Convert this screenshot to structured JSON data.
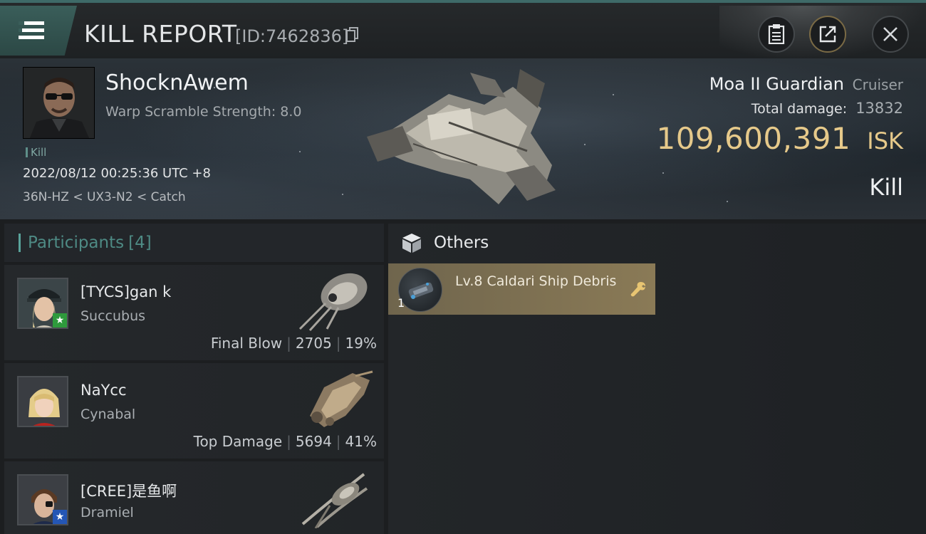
{
  "header": {
    "title": "KILL REPORT",
    "report_id": "[ID:7462836]",
    "icons": [
      "menu-icon",
      "copy-icon",
      "clipboard-icon",
      "share-icon",
      "close-icon"
    ]
  },
  "victim": {
    "name": "ShocknAwem",
    "attribute": "Warp Scramble Strength: 8.0",
    "tag": "Kill",
    "timestamp": "2022/08/12 00:25:36 UTC +8",
    "location": "36N-HZ < UX3-N2 < Catch",
    "ship_name": "Moa II Guardian",
    "ship_class": "Cruiser",
    "total_damage_label": "Total damage:",
    "total_damage": "13832",
    "isk_value": "109,600,391",
    "isk_unit": "ISK",
    "result": "Kill"
  },
  "participants": {
    "label": "Participants",
    "count": "[4]",
    "rows": [
      {
        "name": "[TYCS]gan k",
        "ship": "Succubus",
        "role": "Final Blow",
        "damage": "2705",
        "percent": "19%",
        "badge": "★",
        "badge_color": "#2e9a3c"
      },
      {
        "name": "NaYcc",
        "ship": "Cynabal",
        "role": "Top Damage",
        "damage": "5694",
        "percent": "41%",
        "badge": "",
        "badge_color": ""
      },
      {
        "name": "[CREE]是鱼啊",
        "ship": "Dramiel",
        "role": "",
        "damage": "",
        "percent": "",
        "badge": "★",
        "badge_color": "#2456b5"
      }
    ]
  },
  "others": {
    "label": "Others",
    "items": [
      {
        "name": "Lv.8 Caldari Ship Debris",
        "qty": "1"
      }
    ]
  },
  "colors": {
    "accent": "#5aa39b",
    "isk": "#e6c98a",
    "item_bg": "#8a7a56"
  }
}
